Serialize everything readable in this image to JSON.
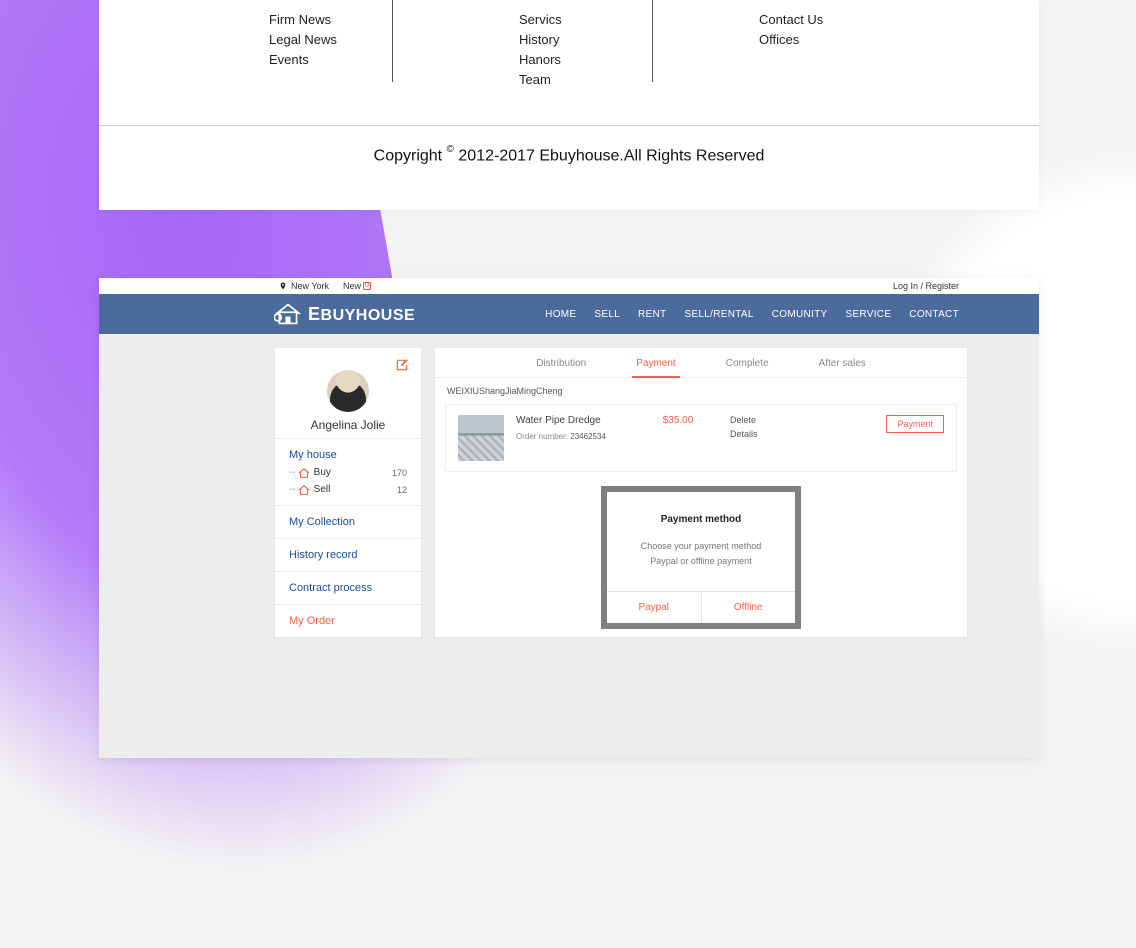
{
  "footer": {
    "col1": [
      "Firm News",
      "Legal News",
      "Events"
    ],
    "col2": [
      "Servics",
      "History",
      "Hanors",
      "Team"
    ],
    "col3": [
      "Contact Us",
      "Offices"
    ],
    "copyright_prefix": "Copyright ",
    "copyright_symbol": "©",
    "copyright_rest": " 2012-2017 Ebuyhouse.All Rights Reserved"
  },
  "topbar": {
    "location": "New York",
    "new_label": "New",
    "login": "Log  In / Register"
  },
  "navbar": {
    "brand": "BUYHOUSE",
    "brand_prefix": "E",
    "links": [
      "HOME",
      "SELL",
      "RENT",
      "SELL/RENTAL",
      "COMUNITY",
      "SERVICE",
      "CONTACT"
    ]
  },
  "sidebar": {
    "user_name": "Angelina Jolie",
    "sections": {
      "my_house": "My house",
      "buy_label": "Buy",
      "buy_count": "170",
      "sell_label": "Sell",
      "sell_count": "12",
      "collection": "My Collection",
      "history": "History record",
      "contract": "Contract process",
      "order": "My Order"
    }
  },
  "tabs": [
    "Distribution",
    "Payment",
    "Complete",
    "After sales"
  ],
  "order": {
    "section_label": "WEIXIUShangJiaMingCheng",
    "title": "Water Pipe Dredge",
    "order_number_label": "Order number:",
    "order_number": "23462534",
    "price": "$35.00",
    "delete": "Delete",
    "details": "Details",
    "pay_button": "Payment"
  },
  "modal": {
    "title": "Payment method",
    "line1": "Choose your payment method",
    "line2": "Paypal or offline payment",
    "paypal": "Paypal",
    "offline": "Offline"
  }
}
